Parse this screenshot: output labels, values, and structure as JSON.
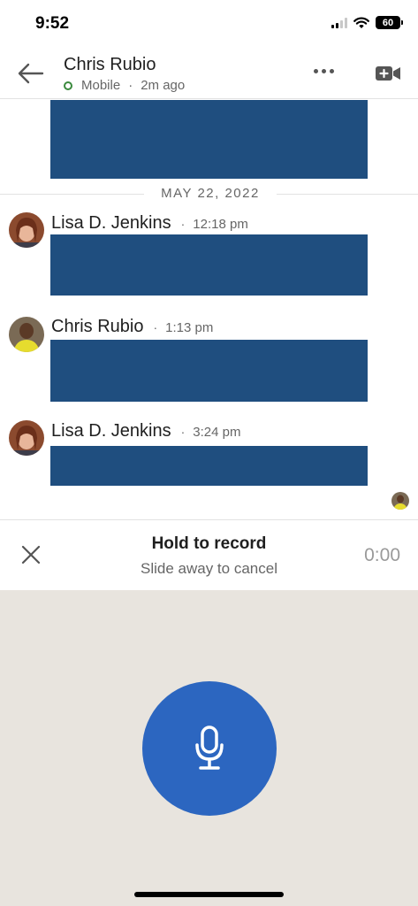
{
  "status_bar": {
    "time": "9:52",
    "battery": "60",
    "icons": [
      "cellular-signal-icon",
      "wifi-icon",
      "battery-icon"
    ]
  },
  "header": {
    "contact_name": "Chris Rubio",
    "presence_status": "Mobile",
    "presence_separator": "·",
    "last_seen": "2m ago",
    "icons": [
      "back-arrow-icon",
      "more-options-icon",
      "video-call-icon"
    ]
  },
  "conversation": {
    "date_divider": "MAY 22, 2022",
    "messages": [
      {
        "sender": "Lisa D. Jenkins",
        "separator": "·",
        "time": "12:18 pm"
      },
      {
        "sender": "Chris Rubio",
        "separator": "·",
        "time": "1:13 pm"
      },
      {
        "sender": "Lisa D. Jenkins",
        "separator": "·",
        "time": "3:24 pm"
      }
    ]
  },
  "record_bar": {
    "title": "Hold to record",
    "subtitle": "Slide away to cancel",
    "timer": "0:00",
    "icons": [
      "close-icon"
    ]
  },
  "record_panel": {
    "icons": [
      "microphone-icon"
    ]
  },
  "colors": {
    "accent": "#2c66c0",
    "message_block": "#1f4e7f",
    "panel_background": "#e8e4de",
    "online": "#3b8a3e"
  }
}
